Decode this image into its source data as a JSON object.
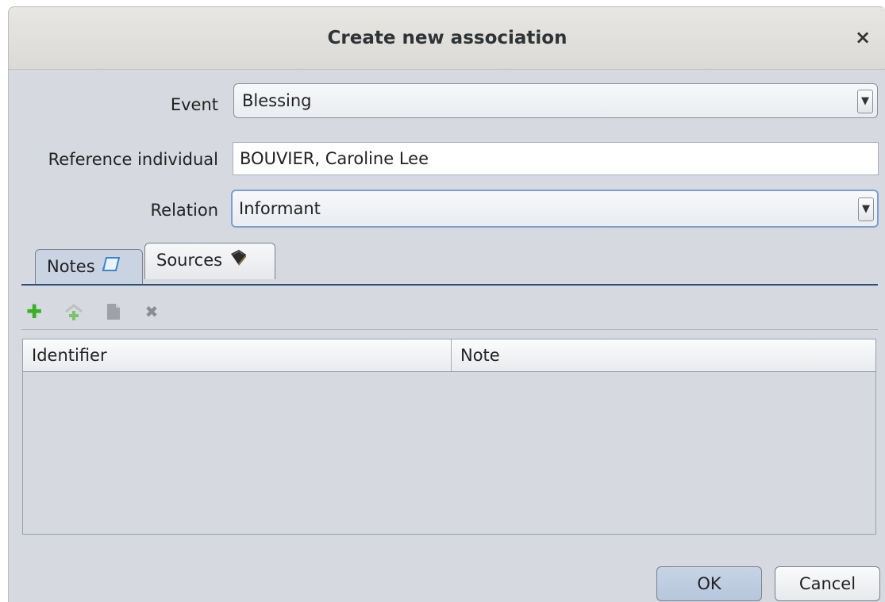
{
  "dialog": {
    "title": "Create new association",
    "close_label": "×"
  },
  "form": {
    "event_label": "Event",
    "event_value": "Blessing",
    "reference_label": "Reference individual",
    "reference_value": "BOUVIER, Caroline Lee",
    "relation_label": "Relation",
    "relation_value": "Informant",
    "dropdown_arrow": "▼"
  },
  "tabs": [
    {
      "label": "Notes",
      "icon": "note-scroll-icon",
      "active": true
    },
    {
      "label": "Sources",
      "icon": "source-book-icon",
      "active": false
    }
  ],
  "toolbar": {
    "add_glyph": "✚",
    "delete_glyph": "✖"
  },
  "table": {
    "columns": [
      "Identifier",
      "Note"
    ],
    "rows": []
  },
  "buttons": {
    "ok": "OK",
    "cancel": "Cancel"
  },
  "colors": {
    "add_green": "#3cae2a",
    "default_button": "#c2d0e4",
    "tab_active": "#c9d3e2"
  }
}
